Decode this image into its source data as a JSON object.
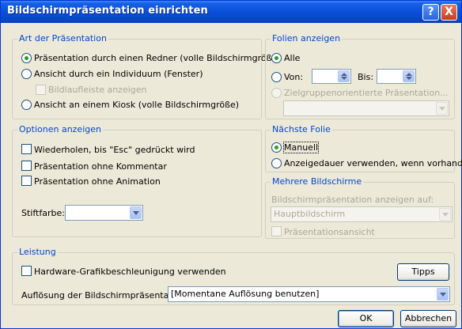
{
  "window": {
    "title": "Bildschirmpräsentation einrichten",
    "help_glyph": "?",
    "close_glyph": "X"
  },
  "art": {
    "title": "Art der Präsentation",
    "opt_redner": "Präsentation durch einen Redner (volle Bildschirmgröße)",
    "opt_individuum": "Ansicht durch ein Individuum (Fenster)",
    "opt_bildlauf": "Bildlaufleiste anzeigen",
    "opt_kiosk": "Ansicht an einem Kiosk (volle Bildschirmgröße)"
  },
  "folien": {
    "title": "Folien anzeigen",
    "opt_alle": "Alle",
    "von_label": "Von:",
    "bis_label": "Bis:",
    "von_value": "",
    "bis_value": "",
    "opt_zielgruppe": "Zielgruppenorientierte Präsentation...",
    "zielgruppe_value": ""
  },
  "optionen": {
    "title": "Optionen anzeigen",
    "chk_wiederholen": "Wiederholen, bis \"Esc\" gedrückt wird",
    "chk_kommentar": "Präsentation ohne Kommentar",
    "chk_animation": "Präsentation ohne Animation",
    "stift_label": "Stiftfarbe:",
    "stift_value": ""
  },
  "naechste": {
    "title": "Nächste Folie",
    "opt_manuell": "Manuell",
    "opt_anzeigedauer": "Anzeigedauer verwenden, wenn vorhanden"
  },
  "mehrere": {
    "title": "Mehrere Bildschirme",
    "anzeigen_label": "Bildschirmpräsentation anzeigen auf:",
    "monitor_value": "Hauptbildschirm",
    "chk_praesentationsansicht": "Präsentationsansicht"
  },
  "leistung": {
    "title": "Leistung",
    "chk_hardware": "Hardware-Grafikbeschleunigung verwenden",
    "tipps_label": "Tipps",
    "aufloesung_label": "Auflösung der Bildschirmpräsentation:",
    "aufloesung_value": "[Momentane Auflösung benutzen]"
  },
  "buttons": {
    "ok": "OK",
    "cancel": "Abbrechen"
  },
  "colors": {
    "group_title": "#0046d5",
    "title_bar": "#0a4fd8",
    "dialog_bg": "#ece9d8",
    "radio_dot": "#21a121"
  }
}
